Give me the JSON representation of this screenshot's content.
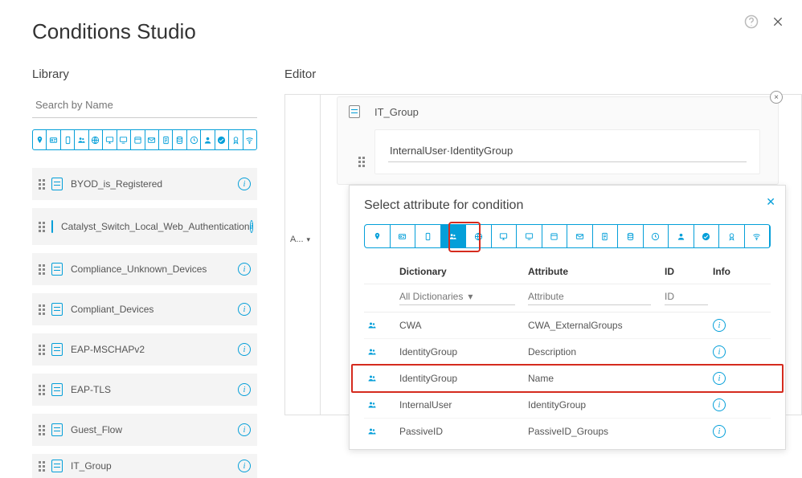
{
  "header": {
    "title": "Conditions Studio"
  },
  "library": {
    "title": "Library",
    "search_placeholder": "Search by Name",
    "items": [
      {
        "label": "BYOD_is_Registered"
      },
      {
        "label": "Catalyst_Switch_Local_Web_Authentication"
      },
      {
        "label": "Compliance_Unknown_Devices"
      },
      {
        "label": "Compliant_Devices"
      },
      {
        "label": "EAP-MSCHAPv2"
      },
      {
        "label": "EAP-TLS"
      },
      {
        "label": "Guest_Flow"
      },
      {
        "label": "IT_Group"
      }
    ]
  },
  "editor": {
    "title": "Editor",
    "logic": "A...",
    "card_title": "IT_Group",
    "field_value": "InternalUser·IdentityGroup"
  },
  "popup": {
    "title": "Select attribute for condition",
    "columns": {
      "dict": "Dictionary",
      "attr": "Attribute",
      "id": "ID",
      "info": "Info"
    },
    "filters": {
      "dict_select": "All Dictionaries",
      "attr_placeholder": "Attribute",
      "id_placeholder": "ID"
    },
    "rows": [
      {
        "dict": "CWA",
        "attr": "CWA_ExternalGroups"
      },
      {
        "dict": "IdentityGroup",
        "attr": "Description"
      },
      {
        "dict": "IdentityGroup",
        "attr": "Name"
      },
      {
        "dict": "InternalUser",
        "attr": "IdentityGroup"
      },
      {
        "dict": "PassiveID",
        "attr": "PassiveID_Groups"
      }
    ]
  }
}
